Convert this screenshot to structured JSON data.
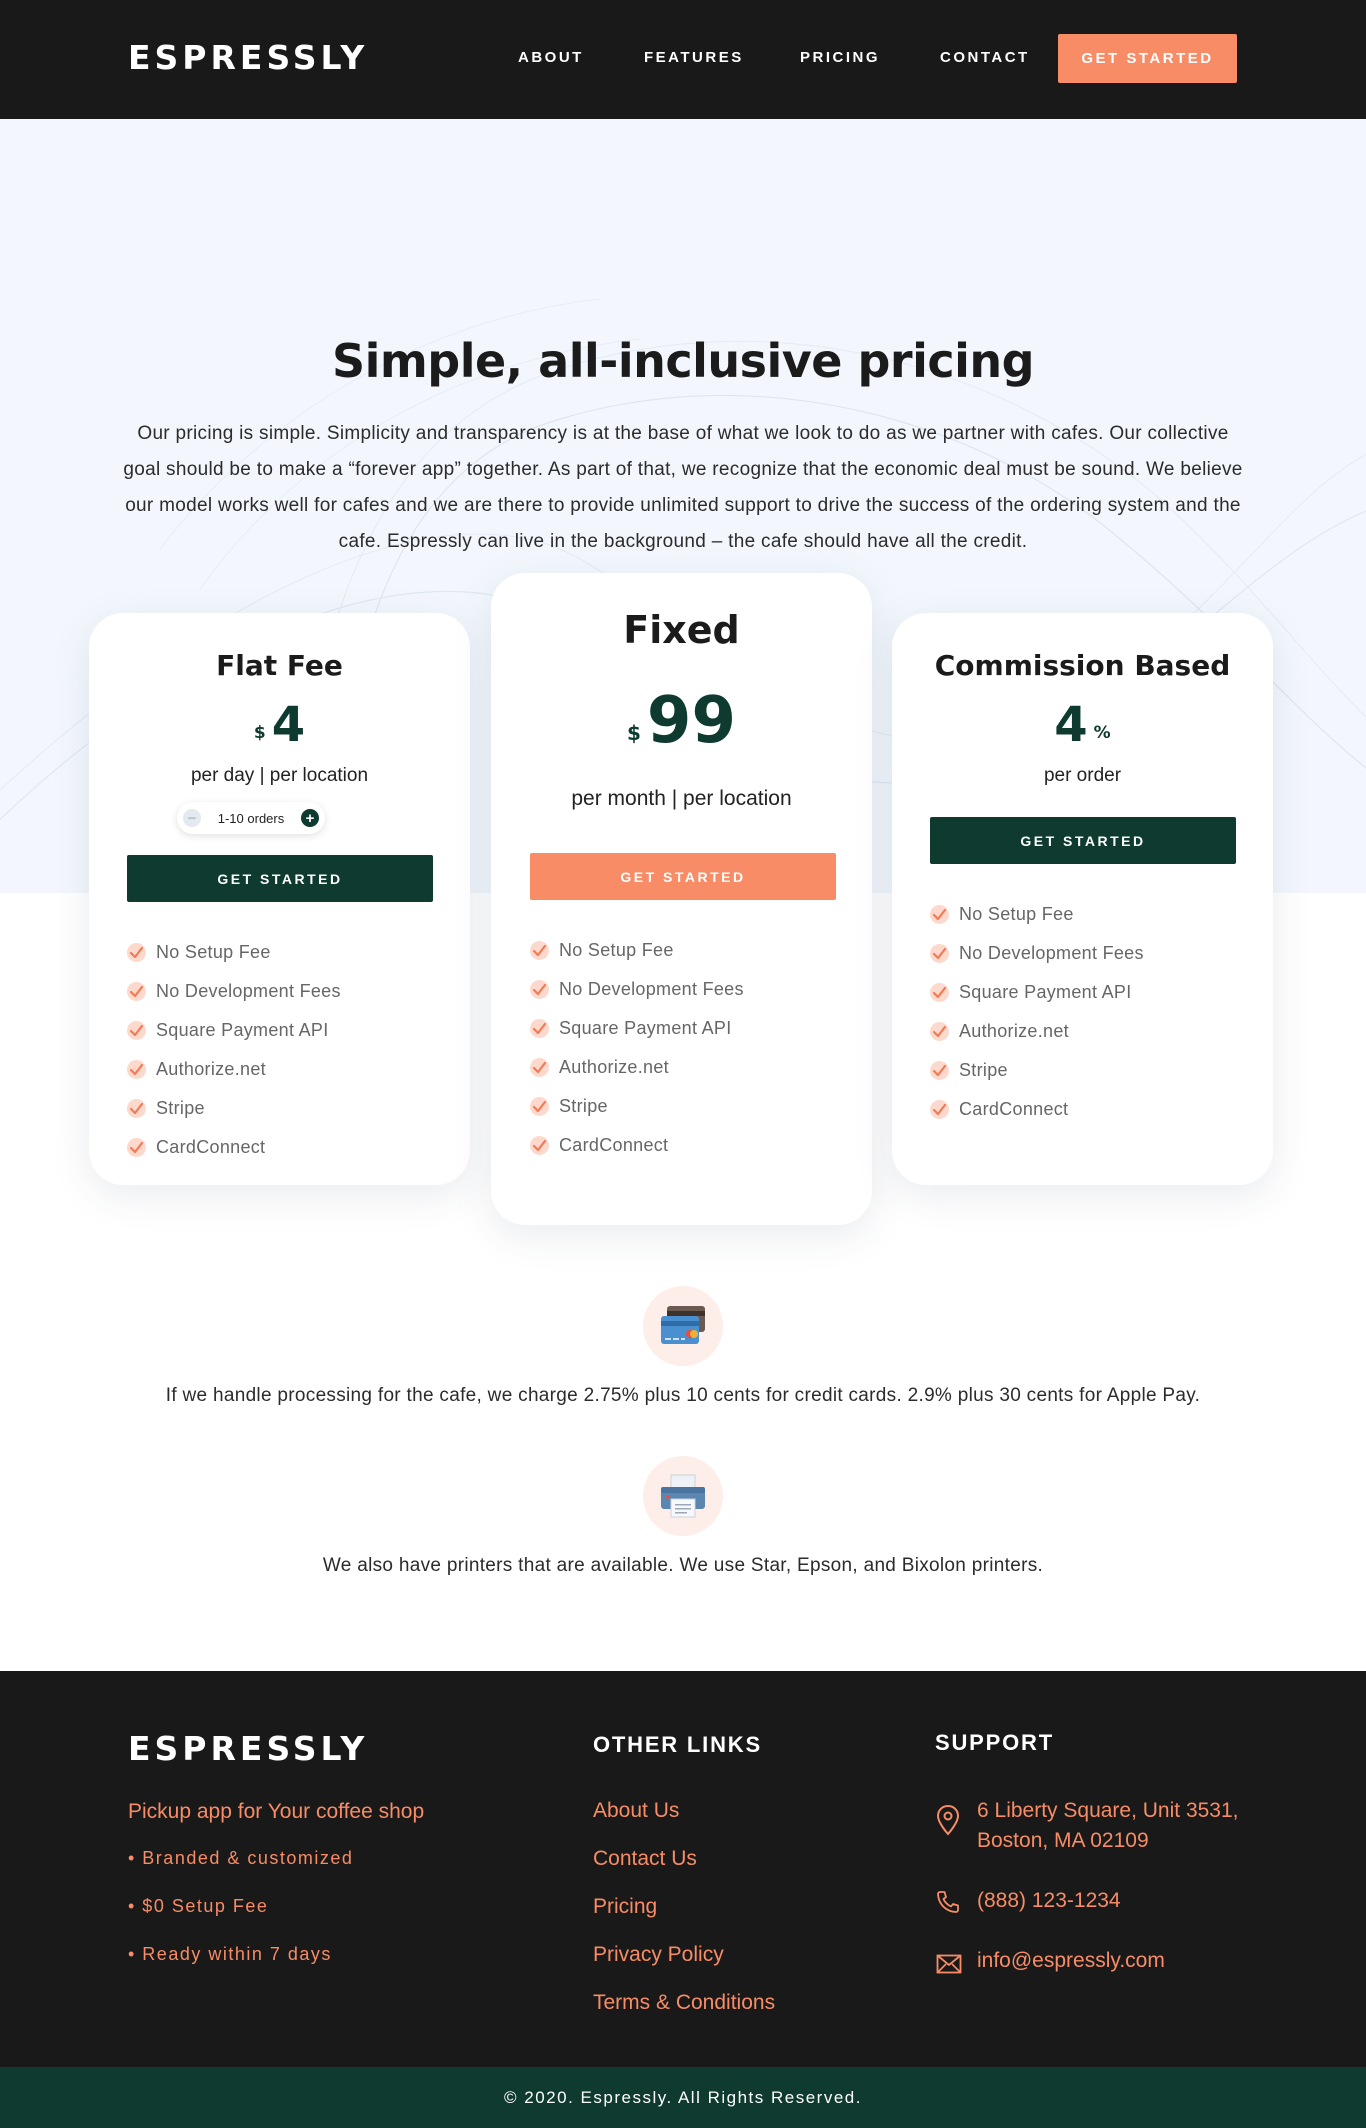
{
  "header": {
    "logo": "ESPRESSLY",
    "nav": [
      "ABOUT",
      "FEATURES",
      "PRICING",
      "CONTACT"
    ],
    "cta": "GET STARTED"
  },
  "hero": {
    "title": "Simple, all-inclusive pricing",
    "text": "Our pricing is simple. Simplicity and transparency is at the base of what we look to do as we partner with cafes. Our collective goal should be to make a “forever app” together. As part of that, we recognize that the economic deal must be sound. We believe our model works well for cafes and we are there to provide unlimited support to drive the success of the ordering system and the cafe. Espressly can live in the background – the cafe should have all the credit."
  },
  "plans": [
    {
      "name": "Flat Fee",
      "currency": "$",
      "amount": "4",
      "unit": "",
      "period": "per day | per location",
      "stepper_value": "1-10 orders",
      "button": "GET STARTED",
      "features": [
        "No Setup Fee",
        "No Development Fees",
        "Square Payment API",
        "Authorize.net",
        "Stripe",
        "CardConnect"
      ]
    },
    {
      "name": "Fixed",
      "currency": "$",
      "amount": "99",
      "unit": "",
      "period": "per month | per location",
      "button": "GET STARTED",
      "features": [
        "No Setup Fee",
        "No Development Fees",
        "Square Payment API",
        "Authorize.net",
        "Stripe",
        "CardConnect"
      ]
    },
    {
      "name": "Commission Based",
      "currency": "",
      "amount": "4",
      "unit": "%",
      "period": "per order",
      "button": "GET STARTED",
      "features": [
        "No Setup Fee",
        "No Development Fees",
        "Square Payment API",
        "Authorize.net",
        "Stripe",
        "CardConnect"
      ]
    }
  ],
  "info": {
    "processing": "If we handle processing for the cafe, we charge 2.75% plus 10 cents for credit cards. 2.9% plus 30 cents for Apple Pay.",
    "printers": "We also have printers that are available. We use Star, Epson, and Bixolon printers."
  },
  "footer": {
    "logo": "ESPRESSLY",
    "tagline": "Pickup app for Your coffee shop",
    "bullets": [
      "• Branded & customized",
      "• $0 Setup Fee",
      "• Ready within 7 days"
    ],
    "links_heading": "OTHER LINKS",
    "links": [
      "About Us",
      "Contact Us",
      "Pricing",
      "Privacy Policy",
      "Terms & Conditions"
    ],
    "support_heading": "SUPPORT",
    "address_line1": "6 Liberty Square, Unit 3531,",
    "address_line2": "Boston, MA 02109",
    "phone": "(888) 123-1234",
    "email": "info@espressly.com",
    "copyright": "© 2020. Espressly. All Rights Reserved."
  },
  "colors": {
    "dark": "#191919",
    "accent": "#f78c66",
    "brand_green": "#0e3a2f",
    "hero_bg": "#f3f7fd"
  },
  "icons": [
    "check-icon",
    "minus-icon",
    "plus-icon",
    "credit-card-icon",
    "printer-icon",
    "map-pin-icon",
    "phone-icon",
    "mail-icon"
  ]
}
